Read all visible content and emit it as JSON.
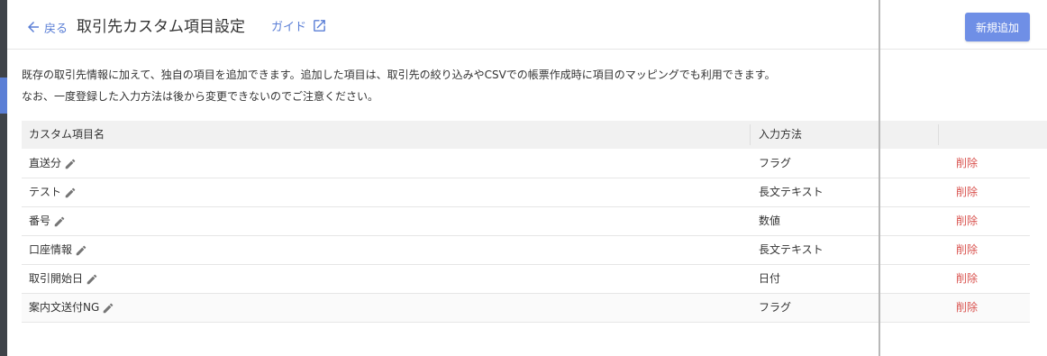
{
  "header": {
    "back_label": "戻る",
    "title": "取引先カスタム項目設定",
    "guide_label": "ガイド",
    "add_button": "新規追加"
  },
  "description": {
    "line1": "既存の取引先情報に加えて、独自の項目を追加できます。追加した項目は、取引先の絞り込みやCSVでの帳票作成時に項目のマッピングでも利用できます。",
    "line2": "なお、一度登録した入力方法は後から変更できないのでご注意ください。"
  },
  "table": {
    "columns": [
      "カスタム項目名",
      "入力方法",
      ""
    ],
    "rows": [
      {
        "name": "直送分",
        "type": "フラグ",
        "action": "削除"
      },
      {
        "name": "テスト",
        "type": "長文テキスト",
        "action": "削除"
      },
      {
        "name": "番号",
        "type": "数値",
        "action": "削除"
      },
      {
        "name": "口座情報",
        "type": "長文テキスト",
        "action": "削除"
      },
      {
        "name": "取引開始日",
        "type": "日付",
        "action": "削除"
      },
      {
        "name": "案内文送付NG",
        "type": "フラグ",
        "action": "削除"
      }
    ]
  },
  "icons": {
    "back": "arrow-left-icon",
    "guide": "open-in-new-icon",
    "edit": "pencil-icon"
  },
  "colors": {
    "accent": "#5b7fd6",
    "button": "#6f8fe6",
    "delete": "#d9534f"
  }
}
